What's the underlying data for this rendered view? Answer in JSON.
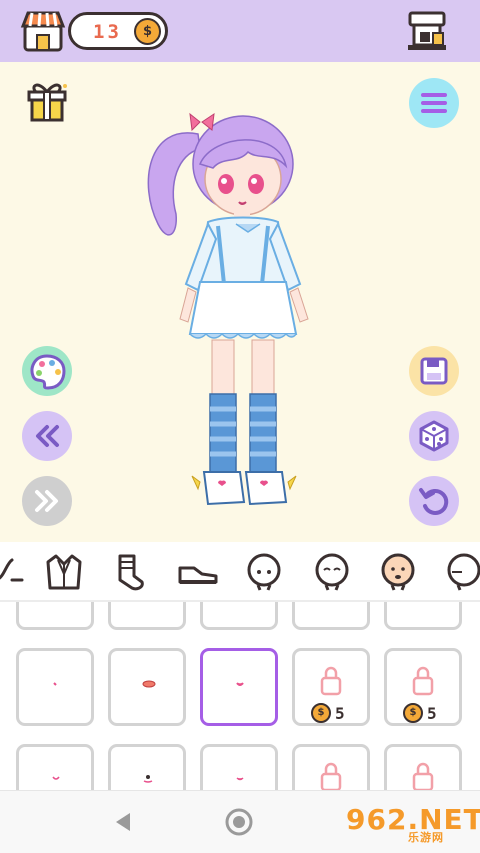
{
  "header": {
    "coins": "13",
    "coin_symbol": "$"
  },
  "stage": {
    "background_color": "#fdf9e6",
    "buttons": [
      "gift-icon",
      "menu-icon",
      "palette-icon",
      "rewind-icon",
      "fast-forward-icon",
      "save-icon",
      "dice-icon",
      "undo-icon"
    ]
  },
  "categories": [
    "shoe-partial-icon",
    "jacket-icon",
    "sock-icon",
    "shoe-icon",
    "head-blank-icon",
    "head-eyes-closed-icon",
    "head-open-mouth-icon",
    "head-side-icon"
  ],
  "grid": {
    "row2": [
      {
        "locked": false
      },
      {
        "locked": false
      },
      {
        "locked": false,
        "selected": true
      },
      {
        "locked": true,
        "price": "5",
        "coin_symbol": "$"
      },
      {
        "locked": true,
        "price": "5",
        "coin_symbol": "$"
      }
    ]
  },
  "watermark": {
    "brand": "962.NET",
    "sub": "乐游网"
  },
  "colors": {
    "topbar": "#d9c8f2",
    "accent_purple": "#a55ee6",
    "coin": "#f4a938"
  }
}
